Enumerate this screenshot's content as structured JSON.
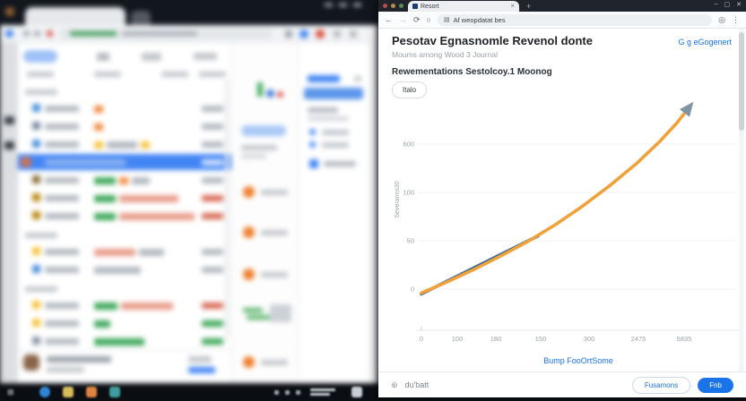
{
  "browser": {
    "tab_title": "Resort",
    "tab_close": "×",
    "new_tab": "+",
    "controls": {
      "minimize": "–",
      "maximize": "▢",
      "close": "✕"
    },
    "nav": {
      "back": "←",
      "forward": "→",
      "reload": "⟳",
      "home": "○"
    },
    "menu": "⋮",
    "site_icon_glyph": "▤",
    "profile_icon_glyph": "◎",
    "url": "Af weopdatat bes"
  },
  "page": {
    "title": "Pesotav Egnasnomle Revenol donte",
    "subtitle": "Moums among Wood 3 Journal",
    "header_link": "G g eGogenert",
    "section_title": "Rewementations Sestolcoy.1 Moonog",
    "filter_button": "Italo",
    "chart_source_link": "Bump FooOrtSome",
    "footer": {
      "status_icon_glyph": "⊛",
      "status_text": "du'batt",
      "secondary_button": "Fusamons",
      "primary_button": "Fnb"
    }
  },
  "chart_data": {
    "type": "line",
    "title": "Rewementations Sestolcoy.1 Moonog",
    "xlabel": "Bump FooOrtSome",
    "ylabel": "Severanns30",
    "x_range": [
      0,
      350
    ],
    "y_range": [
      -12,
      192
    ],
    "grid": true,
    "legend": false,
    "x_ticks": [
      {
        "v": 0,
        "label": "0"
      },
      {
        "v": 40,
        "label": "100"
      },
      {
        "v": 83,
        "label": "180"
      },
      {
        "v": 133,
        "label": "150"
      },
      {
        "v": 187,
        "label": "300"
      },
      {
        "v": 242,
        "label": "2475"
      },
      {
        "v": 293,
        "label": "5835"
      }
    ],
    "y_ticks": [
      {
        "v": 0,
        "label": "0"
      },
      {
        "v": 50,
        "label": "50"
      },
      {
        "v": 100,
        "label": "100"
      },
      {
        "v": 150,
        "label": "600"
      }
    ],
    "series": [
      {
        "name": "baseline-linear",
        "color": "#3a689b",
        "x": [
          0,
          130
        ],
        "y": [
          -5,
          55
        ]
      },
      {
        "name": "growth-exponential",
        "color": "#f0a23a",
        "x": [
          0,
          30,
          60,
          90,
          120,
          150,
          180,
          210,
          240,
          265,
          285,
          296
        ],
        "y": [
          -4,
          8,
          21,
          35,
          50,
          67,
          86,
          107,
          130,
          152,
          172,
          185
        ]
      }
    ],
    "annotation": {
      "type": "arrowhead",
      "color": "#7d95a5"
    }
  }
}
